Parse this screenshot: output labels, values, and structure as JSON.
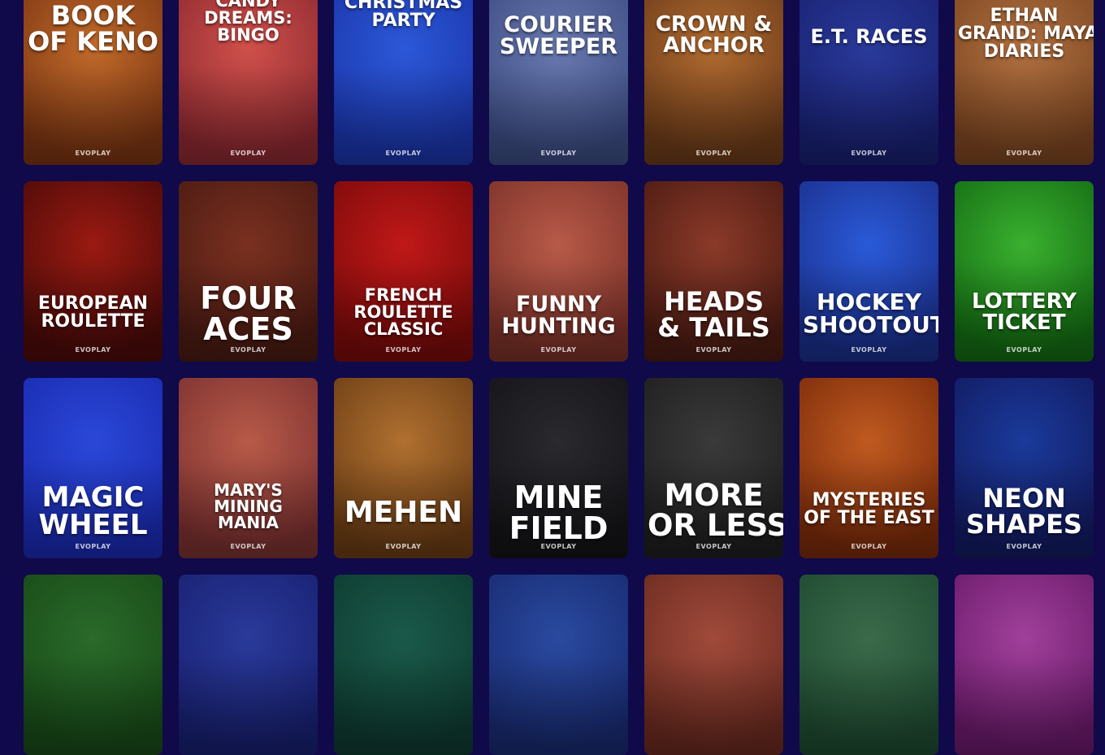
{
  "provider": "EVOPLAY",
  "games": [
    {
      "id": "book-of-keno",
      "lines": [
        "BOOK",
        "OF KENO"
      ],
      "provider": "EVOPLAY",
      "colors": [
        "#c06a2a",
        "#7a3412"
      ]
    },
    {
      "id": "candy-dreams-bingo",
      "lines": [
        "CANDY",
        "DREAMS:",
        "BINGO"
      ],
      "provider": "EVOPLAY",
      "colors": [
        "#d0504a",
        "#8a2830"
      ]
    },
    {
      "id": "christmas-party",
      "lines": [
        "CHRISTMAS",
        "PARTY"
      ],
      "provider": "EVOPLAY",
      "colors": [
        "#2c58d8",
        "#1a34a8"
      ]
    },
    {
      "id": "courier-sweeper",
      "lines": [
        "COURIER",
        "SWEEPER"
      ],
      "provider": "EVOPLAY",
      "colors": [
        "#6a7ab0",
        "#3a4a80"
      ]
    },
    {
      "id": "crown-anchor",
      "lines": [
        "CROWN &",
        "ANCHOR"
      ],
      "provider": "EVOPLAY",
      "colors": [
        "#b06a30",
        "#6a3a18"
      ]
    },
    {
      "id": "et-races",
      "lines": [
        "E.T. RACES"
      ],
      "provider": "EVOPLAY",
      "colors": [
        "#2a3a9a",
        "#182070"
      ]
    },
    {
      "id": "ethan-grand",
      "lines": [
        "ETHAN",
        "GRAND: MAYAN",
        "DIARIES"
      ],
      "provider": "EVOPLAY",
      "colors": [
        "#b07040",
        "#7a4420"
      ]
    },
    {
      "id": "european-roulette",
      "lines": [
        "EUROPEAN",
        "ROULETTE"
      ],
      "provider": "EVOPLAY",
      "colors": [
        "#9a1a12",
        "#4a0a08"
      ]
    },
    {
      "id": "four-aces",
      "lines": [
        "FOUR",
        "ACES"
      ],
      "provider": "EVOPLAY",
      "colors": [
        "#7a3020",
        "#4a1a12"
      ]
    },
    {
      "id": "french-roulette",
      "lines": [
        "FRENCH",
        "ROULETTE",
        "CLASSIC"
      ],
      "provider": "EVOPLAY",
      "colors": [
        "#c01818",
        "#7a0a0a"
      ]
    },
    {
      "id": "funny-hunting",
      "lines": [
        "FUNNY",
        "HUNTING"
      ],
      "provider": "EVOPLAY",
      "colors": [
        "#b85a48",
        "#7a3028"
      ]
    },
    {
      "id": "heads-tails",
      "lines": [
        "HEADS",
        "& TAILS"
      ],
      "provider": "EVOPLAY",
      "colors": [
        "#8a3a28",
        "#4a1a12"
      ]
    },
    {
      "id": "hockey-shootout",
      "lines": [
        "HOCKEY",
        "SHOOTOUT"
      ],
      "provider": "EVOPLAY",
      "colors": [
        "#2a5ad8",
        "#1a2e8a"
      ]
    },
    {
      "id": "lottery-ticket",
      "lines": [
        "LOTTERY",
        "TICKET"
      ],
      "provider": "EVOPLAY",
      "colors": [
        "#3ab030",
        "#136a12"
      ]
    },
    {
      "id": "magic-wheel",
      "lines": [
        "MAGIC",
        "WHEEL"
      ],
      "provider": "EVOPLAY",
      "colors": [
        "#2a48d8",
        "#1a2ab0"
      ]
    },
    {
      "id": "marys-mining-mania",
      "lines": [
        "MARY'S",
        "MINING",
        "MANIA"
      ],
      "provider": "EVOPLAY",
      "colors": [
        "#b85a48",
        "#7a3030"
      ]
    },
    {
      "id": "mehen",
      "lines": [
        "MEHEN"
      ],
      "provider": "EVOPLAY",
      "colors": [
        "#b07030",
        "#6a3c14"
      ]
    },
    {
      "id": "mine-field",
      "lines": [
        "MINE",
        "FIELD"
      ],
      "provider": "EVOPLAY",
      "colors": [
        "#2a2a2e",
        "#141418"
      ]
    },
    {
      "id": "more-or-less",
      "lines": [
        "MORE",
        "OR LESS"
      ],
      "provider": "EVOPLAY",
      "colors": [
        "#3a3a3a",
        "#1e1e1e"
      ]
    },
    {
      "id": "mysteries-east",
      "lines": [
        "MYSTERIES",
        "OF THE EAST"
      ],
      "provider": "EVOPLAY",
      "colors": [
        "#c05a20",
        "#7a2a0a"
      ]
    },
    {
      "id": "neon-shapes",
      "lines": [
        "NEON",
        "SHAPES"
      ],
      "provider": "EVOPLAY",
      "colors": [
        "#1a3a9a",
        "#121a60"
      ]
    },
    {
      "id": "row4-1",
      "lines": [],
      "provider": "",
      "colors": [
        "#2a6a2a",
        "#184a18"
      ]
    },
    {
      "id": "row4-2",
      "lines": [],
      "provider": "",
      "colors": [
        "#2a3a9a",
        "#182070"
      ]
    },
    {
      "id": "row4-3",
      "lines": [],
      "provider": "",
      "colors": [
        "#1a5a4a",
        "#0e3a30"
      ]
    },
    {
      "id": "row4-4",
      "lines": [],
      "provider": "",
      "colors": [
        "#2a4aa0",
        "#182a70"
      ]
    },
    {
      "id": "row4-5",
      "lines": [],
      "provider": "",
      "colors": [
        "#a04a3a",
        "#6a2a20"
      ]
    },
    {
      "id": "row4-6",
      "lines": [],
      "provider": "",
      "colors": [
        "#3a6a4a",
        "#1e4a30"
      ]
    },
    {
      "id": "row4-7",
      "lines": [],
      "provider": "",
      "colors": [
        "#a0409a",
        "#6a1a6a"
      ]
    }
  ]
}
